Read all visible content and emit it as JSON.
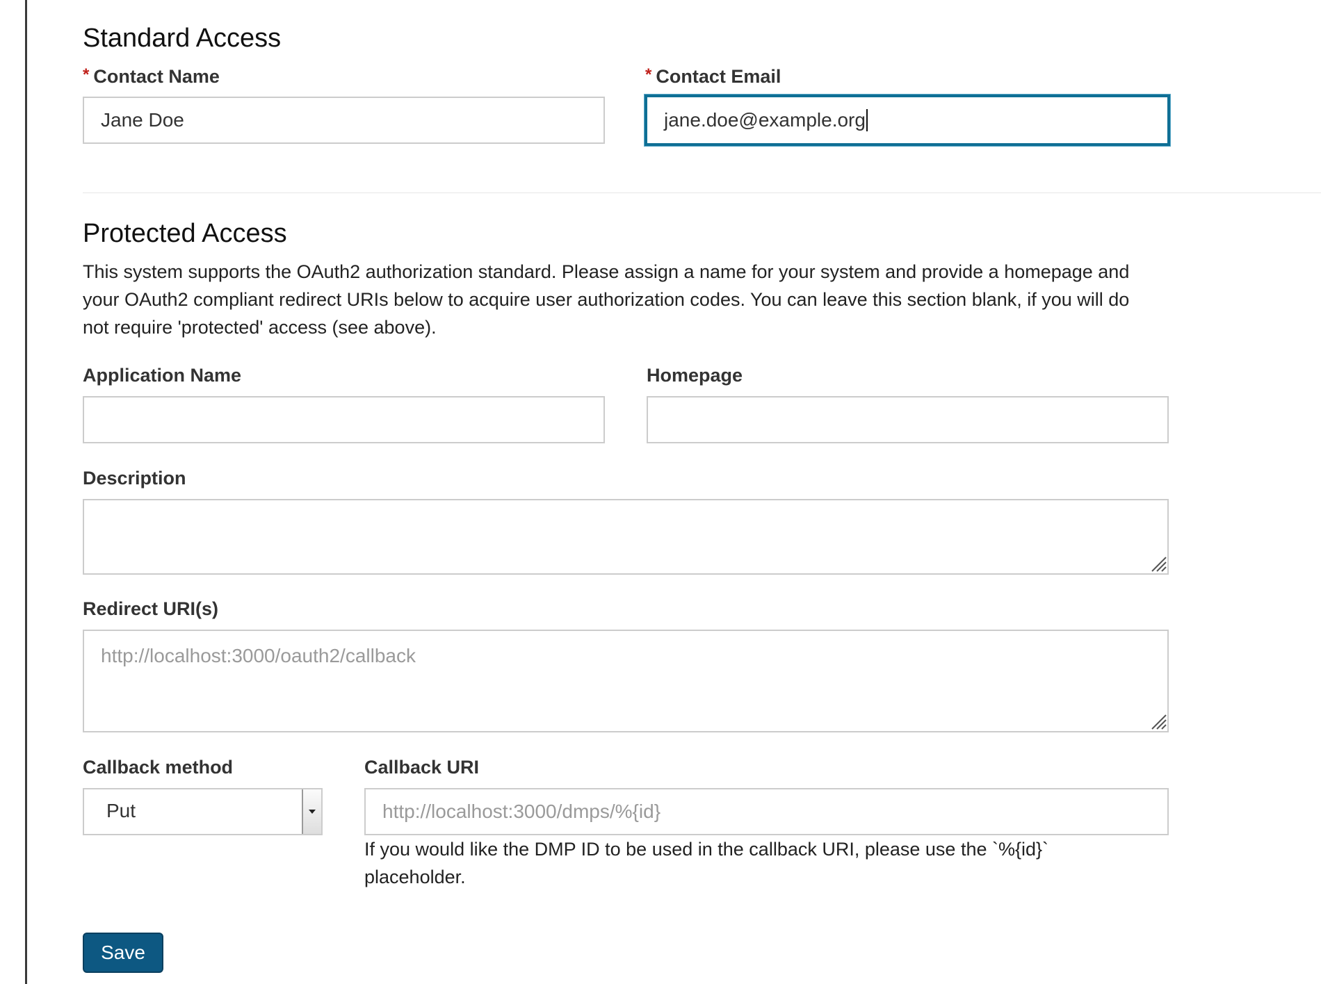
{
  "standard_access": {
    "heading": "Standard Access",
    "required_marker": "*",
    "contact_name": {
      "label": "Contact Name",
      "value": "Jane Doe"
    },
    "contact_email": {
      "label": "Contact Email",
      "value": "jane.doe@example.org"
    }
  },
  "protected_access": {
    "heading": "Protected Access",
    "description_lines": [
      "This system supports the OAuth2 authorization standard. Please assign a name for your system and provide a homepage and",
      "your OAuth2 compliant redirect URIs below to acquire user authorization codes. You can leave this section blank, if you will do",
      "not require 'protected' access (see above)."
    ],
    "application_name": {
      "label": "Application Name",
      "value": ""
    },
    "homepage": {
      "label": "Homepage",
      "value": ""
    },
    "description": {
      "label": "Description",
      "value": ""
    },
    "redirect_uris": {
      "label": "Redirect URI(s)",
      "value": "",
      "placeholder": "http://localhost:3000/oauth2/callback"
    },
    "callback_method": {
      "label": "Callback method",
      "selected": "Put"
    },
    "callback_uri": {
      "label": "Callback URI",
      "value": "",
      "placeholder": "http://localhost:3000/dmps/%{id}",
      "help_lines": [
        "If you would like the DMP ID to be used in the callback URI, please use the `%{id}`",
        "placeholder."
      ]
    }
  },
  "actions": {
    "save_label": "Save"
  },
  "colors": {
    "accent": "#0d5882",
    "focus_border": "#0f6f95",
    "required": "#c0201a"
  }
}
